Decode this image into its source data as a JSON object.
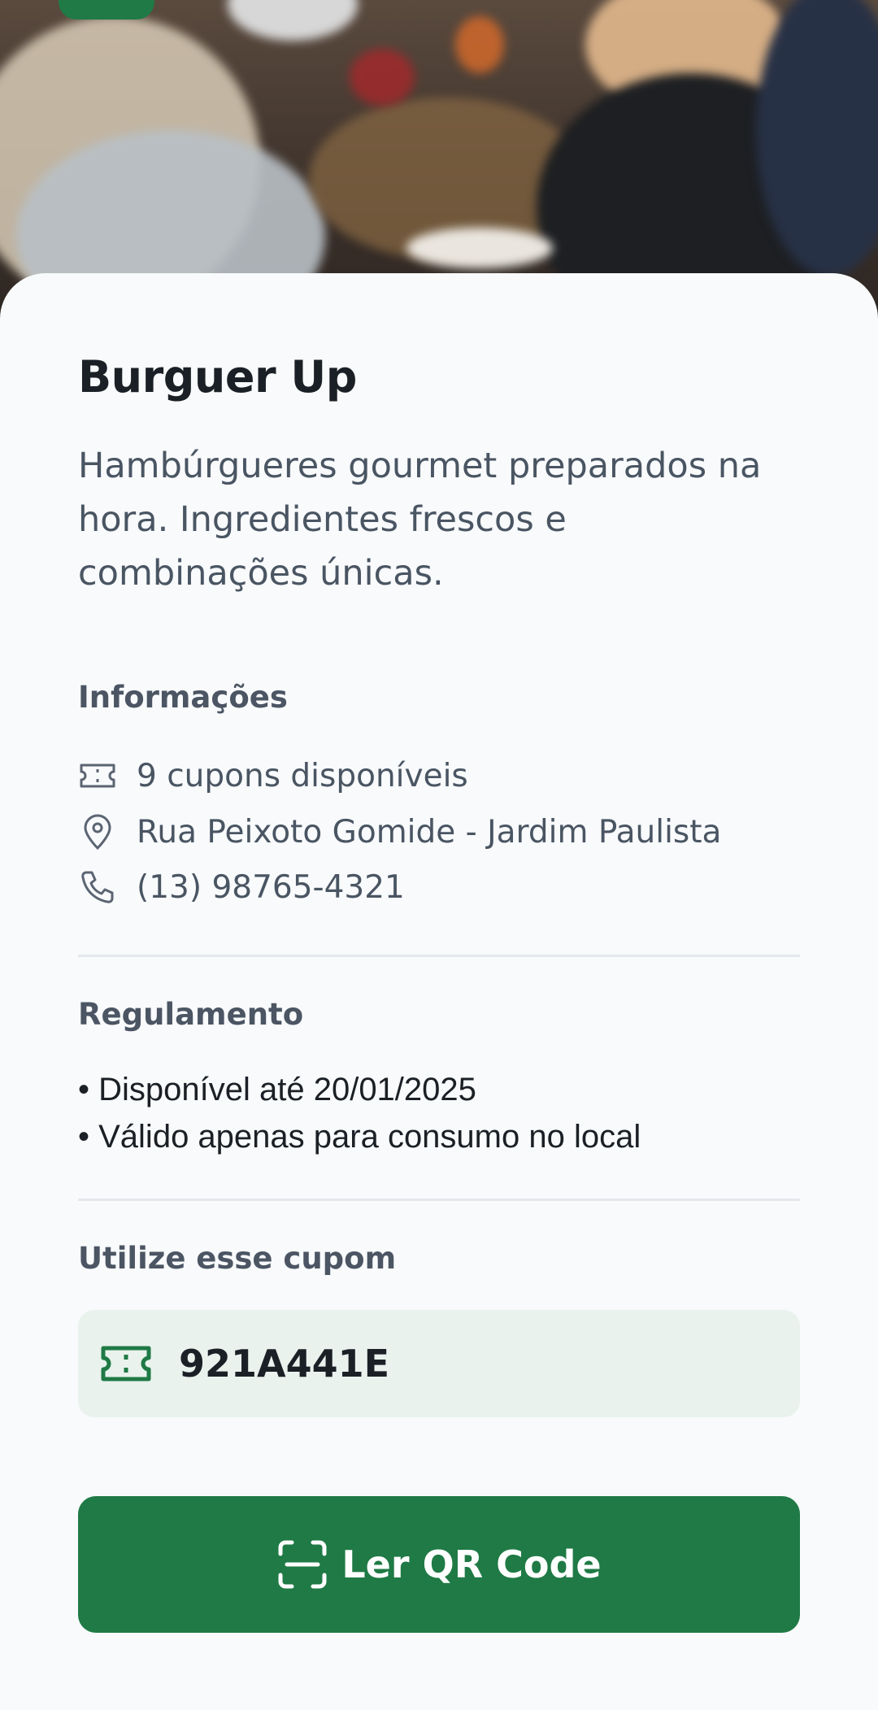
{
  "restaurant": {
    "name": "Burguer Up",
    "description": "Hambúrgueres gourmet preparados na hora. Ingredientes frescos e combinações únicas."
  },
  "info": {
    "heading": "Informações",
    "items": [
      {
        "icon": "ticket-icon",
        "text": "9 cupons disponíveis"
      },
      {
        "icon": "map-pin-icon",
        "text": "Rua Peixoto Gomide - Jardim Paulista"
      },
      {
        "icon": "phone-icon",
        "text": "(13) 98765-4321"
      }
    ]
  },
  "rules": {
    "heading": "Regulamento",
    "items": [
      "• Disponível até 20/01/2025",
      "• Válido apenas para consumo no local"
    ]
  },
  "coupon": {
    "heading": "Utilize esse cupom",
    "code": "921A441E",
    "icon": "ticket-icon"
  },
  "action": {
    "label": "Ler QR Code",
    "icon": "qr-scan-icon"
  },
  "colors": {
    "primary": "#1f7a45",
    "coupon_bg": "#e9f2ed",
    "text_dark": "#1b2026",
    "text_muted": "#4a5563"
  }
}
